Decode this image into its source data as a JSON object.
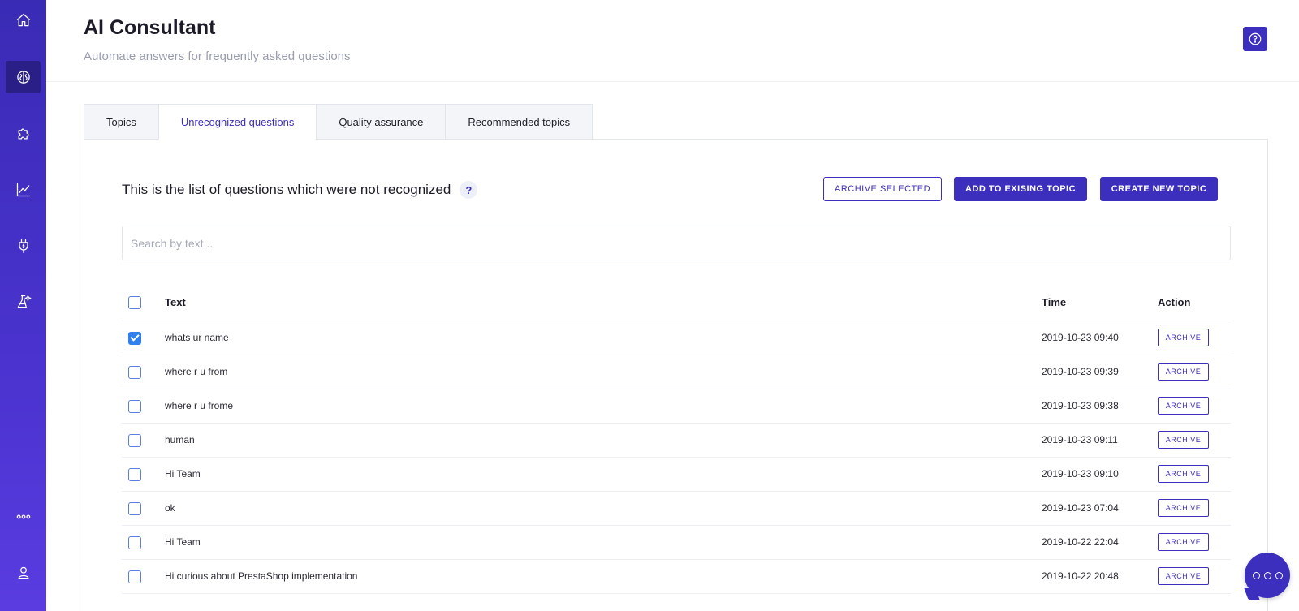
{
  "header": {
    "title": "AI Consultant",
    "subtitle": "Automate answers for frequently asked questions"
  },
  "sidebar": {
    "items": [
      {
        "icon": "home-icon"
      },
      {
        "icon": "brain-icon",
        "active": true
      },
      {
        "icon": "puzzle-icon"
      },
      {
        "icon": "chart-line-icon"
      },
      {
        "icon": "plug-icon"
      },
      {
        "icon": "flask-icon"
      },
      {
        "icon": "more-icon"
      },
      {
        "icon": "user-icon"
      }
    ]
  },
  "tabs": [
    {
      "label": "Topics"
    },
    {
      "label": "Unrecognized questions",
      "active": true
    },
    {
      "label": "Quality assurance"
    },
    {
      "label": "Recommended topics"
    }
  ],
  "panel": {
    "heading": "This is the list of questions which were not recognized",
    "help_badge": "?",
    "archive_selected_label": "ARCHIVE SELECTED",
    "add_existing_label": "ADD TO EXISING TOPIC",
    "create_new_label": "CREATE NEW TOPIC",
    "search_placeholder": "Search by text..."
  },
  "table": {
    "headers": {
      "text": "Text",
      "time": "Time",
      "action": "Action"
    },
    "action_label": "ARCHIVE",
    "rows": [
      {
        "text": "whats ur name",
        "time": "2019-10-23 09:40",
        "checked": true
      },
      {
        "text": "where r u from",
        "time": "2019-10-23 09:39",
        "checked": false
      },
      {
        "text": "where r u frome",
        "time": "2019-10-23 09:38",
        "checked": false
      },
      {
        "text": "human",
        "time": "2019-10-23 09:11",
        "checked": false
      },
      {
        "text": "Hi Team",
        "time": "2019-10-23 09:10",
        "checked": false
      },
      {
        "text": "ok",
        "time": "2019-10-23 07:04",
        "checked": false
      },
      {
        "text": "Hi Team",
        "time": "2019-10-22 22:04",
        "checked": false
      },
      {
        "text": "Hi curious about PrestaShop implementation",
        "time": "2019-10-22 20:48",
        "checked": false
      }
    ]
  },
  "colors": {
    "accent": "#3c2fbd",
    "sidebar_top": "#3a2bb5",
    "sidebar_bottom": "#5a3ce0",
    "checkbox_checked": "#2f80ed"
  }
}
